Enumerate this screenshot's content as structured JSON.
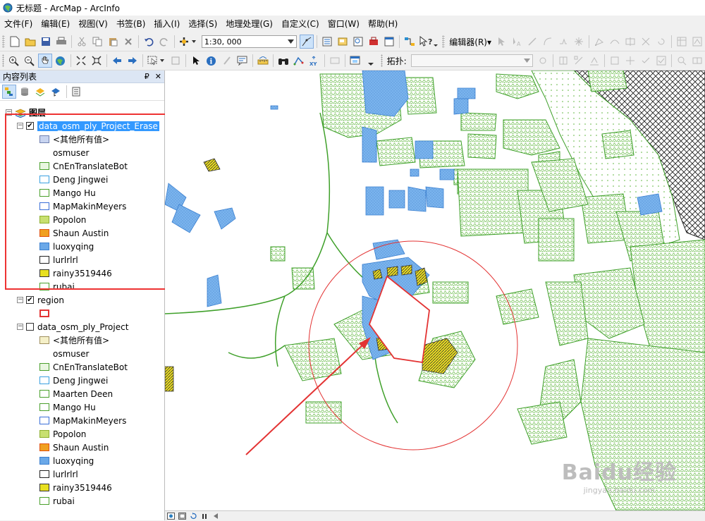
{
  "window": {
    "title": "无标题 - ArcMap - ArcInfo"
  },
  "menu": [
    "文件(F)",
    "编辑(E)",
    "视图(V)",
    "书签(B)",
    "插入(I)",
    "选择(S)",
    "地理处理(G)",
    "自定义(C)",
    "窗口(W)",
    "帮助(H)"
  ],
  "toolbar": {
    "scale_value": "1:30, 000",
    "editor_label": "编辑器(R)▾",
    "topology_label": "拓扑:"
  },
  "toc": {
    "title": "内容列表",
    "pin": "₽",
    "close": "✕",
    "root_label": "图层",
    "layer1": {
      "name": "data_osm_ply_Project_Erase",
      "items": [
        {
          "label": "<其他所有值>",
          "fill": "#c8d4f0",
          "stroke": "#7080b0"
        },
        {
          "label": "osmuser",
          "fill": "none",
          "stroke": "none"
        },
        {
          "label": "CnEnTranslateBot",
          "fill": "#e9f6e0",
          "stroke": "#4aa02c"
        },
        {
          "label": "Deng Jingwei",
          "fill": "#ffffff",
          "stroke": "#3aa0e0"
        },
        {
          "label": "Mango Hu",
          "fill": "#ffffff",
          "stroke": "#4aa02c"
        },
        {
          "label": "MapMakinMeyers",
          "fill": "#ffffff",
          "stroke": "#3a6fd8"
        },
        {
          "label": "Popolon",
          "fill": "#c8e070",
          "stroke": "#8db030"
        },
        {
          "label": "Shaun Austin",
          "fill": "#f0a020",
          "stroke": "#e05010"
        },
        {
          "label": "luoxyqing",
          "fill": "#6aa8e8",
          "stroke": "#3a7fcf"
        },
        {
          "label": "lurlrlrl",
          "fill": "#ffffff",
          "stroke": "#222222"
        },
        {
          "label": "rainy3519446",
          "fill": "#e8e020",
          "stroke": "#333333"
        },
        {
          "label": "rubai",
          "fill": "#ffffff",
          "stroke": "#4aa02c"
        }
      ]
    },
    "layer2": {
      "name": "region"
    },
    "layer3": {
      "name": "data_osm_ply_Project",
      "items": [
        {
          "label": "<其他所有值>",
          "fill": "#f5f0c8",
          "stroke": "#a09060"
        },
        {
          "label": "osmuser",
          "fill": "none",
          "stroke": "none"
        },
        {
          "label": "CnEnTranslateBot",
          "fill": "#e9f6e0",
          "stroke": "#4aa02c"
        },
        {
          "label": "Deng Jingwei",
          "fill": "#ffffff",
          "stroke": "#3aa0e0"
        },
        {
          "label": "Maarten Deen",
          "fill": "#ffffff",
          "stroke": "#4aa02c"
        },
        {
          "label": "Mango Hu",
          "fill": "#ffffff",
          "stroke": "#4aa02c"
        },
        {
          "label": "MapMakinMeyers",
          "fill": "#ffffff",
          "stroke": "#3a6fd8"
        },
        {
          "label": "Popolon",
          "fill": "#c8e070",
          "stroke": "#8db030"
        },
        {
          "label": "Shaun Austin",
          "fill": "#f0a020",
          "stroke": "#e05010"
        },
        {
          "label": "luoxyqing",
          "fill": "#6aa8e8",
          "stroke": "#3a7fcf"
        },
        {
          "label": "lurlrlrl",
          "fill": "#ffffff",
          "stroke": "#222222"
        },
        {
          "label": "rainy3519446",
          "fill": "#e8e020",
          "stroke": "#333333"
        },
        {
          "label": "rubai",
          "fill": "#ffffff",
          "stroke": "#4aa02c"
        }
      ]
    }
  },
  "colors": {
    "green_polygon": "#3fa02a",
    "blue_polygon": "#6aa8e8",
    "yellow_polygon": "#e8e020",
    "highlight_red": "#e33333"
  },
  "watermark": {
    "main": "Baidu经验",
    "sub": "jingyan.baidu.com"
  }
}
